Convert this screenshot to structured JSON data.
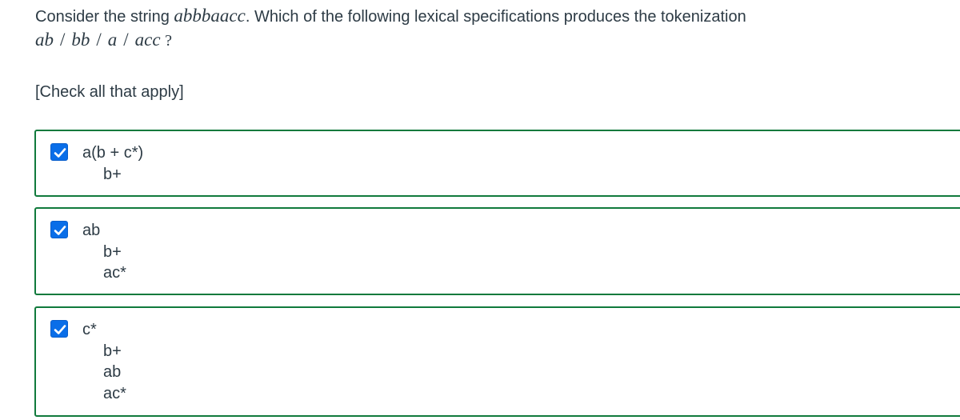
{
  "question": {
    "prefix": "Consider the string ",
    "string": "abbbaacc",
    "suffix": ". Which of the following lexical specifications produces the tokenization",
    "tokens": [
      "ab",
      "bb",
      "a",
      "acc"
    ],
    "slash": "/",
    "qmark": "?"
  },
  "instruction": "[Check all that apply]",
  "options": [
    {
      "checked": true,
      "lines": [
        "a(b + c*)",
        "b+"
      ]
    },
    {
      "checked": true,
      "lines": [
        "ab",
        "b+",
        "ac*"
      ]
    },
    {
      "checked": true,
      "lines": [
        "c*",
        "b+",
        "ab",
        "ac*"
      ]
    }
  ],
  "colors": {
    "checkbox": "#0a6ee8",
    "option_border": "#107a3c",
    "text": "#2d3b45"
  },
  "icons": {
    "checkbox_mark": "checkmark-icon"
  }
}
